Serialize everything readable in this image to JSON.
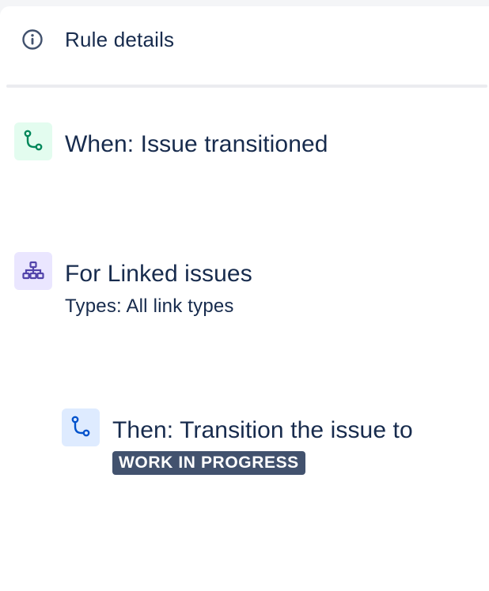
{
  "details": {
    "label": "Rule details",
    "icon": "info-icon"
  },
  "trigger": {
    "title": "When: Issue transitioned",
    "icon": "transition-icon",
    "color": "#00875a"
  },
  "branch": {
    "title": "For Linked issues",
    "subtitle": "Types: All link types",
    "icon": "branch-icon",
    "color": "#5243aa"
  },
  "action": {
    "title": "Then: Transition the issue to",
    "status": "WORK IN PROGRESS",
    "icon": "transition-icon",
    "color": "#0052cc"
  }
}
